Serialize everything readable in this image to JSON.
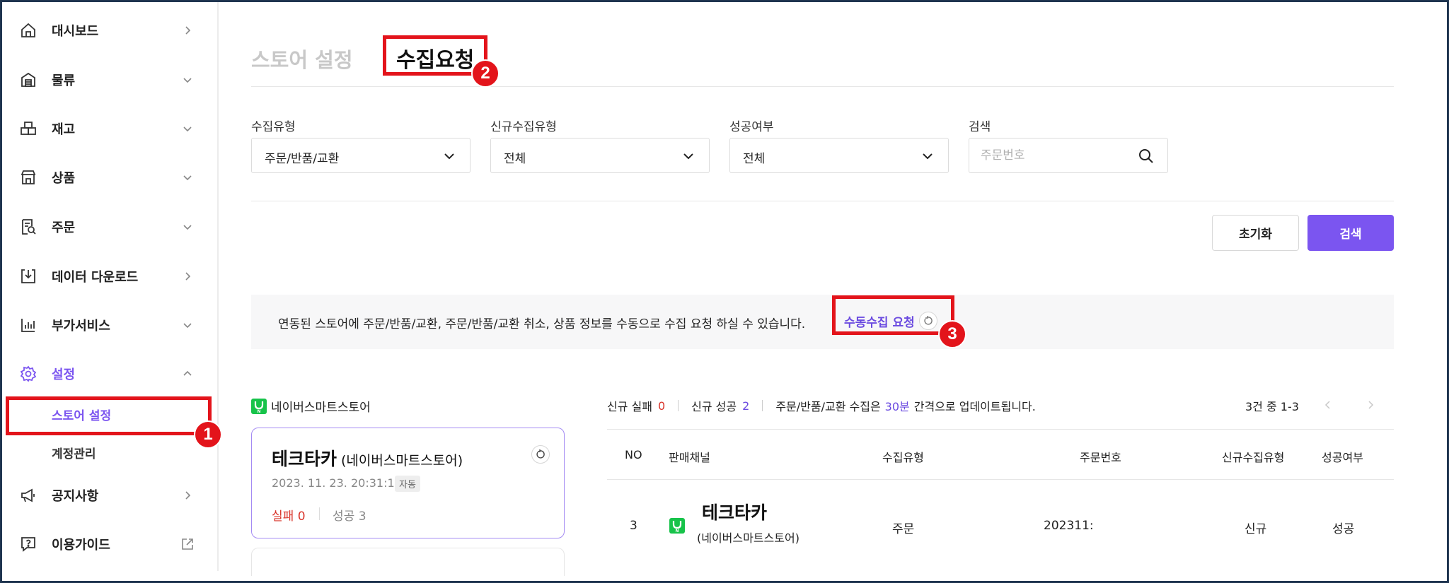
{
  "sidebar": {
    "items": [
      {
        "label": "대시보드",
        "icon": "home-icon"
      },
      {
        "label": "물류",
        "icon": "warehouse-icon"
      },
      {
        "label": "재고",
        "icon": "boxes-icon"
      },
      {
        "label": "상품",
        "icon": "store-icon"
      },
      {
        "label": "주문",
        "icon": "order-list-icon"
      },
      {
        "label": "데이터 다운로드",
        "icon": "download-icon"
      },
      {
        "label": "부가서비스",
        "icon": "chart-plus-icon"
      },
      {
        "label": "설정",
        "icon": "gear-icon"
      },
      {
        "label": "공지사항",
        "icon": "megaphone-icon"
      },
      {
        "label": "이용가이드",
        "icon": "help-icon"
      }
    ],
    "sub_items": [
      {
        "label": "스토어 설정"
      },
      {
        "label": "계정관리"
      }
    ],
    "accent_color": "#7b55f0"
  },
  "tabs": {
    "store_settings": "스토어 설정",
    "collect_request": "수집요청"
  },
  "filters": {
    "collect_type": {
      "label": "수집유형",
      "value": "주문/반품/교환"
    },
    "new_collect_type": {
      "label": "신규수집유형",
      "value": "전체"
    },
    "success": {
      "label": "성공여부",
      "value": "전체"
    },
    "search": {
      "label": "검색",
      "placeholder": "주문번호"
    }
  },
  "buttons": {
    "reset": "초기화",
    "search": "검색"
  },
  "notice": {
    "text": "연동된 스토어에 주문/반품/교환, 주문/반품/교환 취소, 상품 정보를 수동으로 수집 요청 하실 수 있습니다.",
    "manual_request": "수동수집 요청"
  },
  "store_list": {
    "channel_label": "네이버스마트스토어",
    "card": {
      "name": "테크타카",
      "channel": "(네이버스마트스토어)",
      "datetime": "2023. 11. 23. 20:31:12",
      "badge": "자동",
      "fail_label": "실패",
      "fail_count": "0",
      "success_label": "성공",
      "success_count": "3"
    }
  },
  "results": {
    "new_fail_label": "신규 실패",
    "new_fail_count": "0",
    "new_success_label": "신규 성공",
    "new_success_count": "2",
    "interval_prefix": "주문/반품/교환 수집은",
    "interval_value": "30분",
    "interval_suffix": "간격으로 업데이트됩니다.",
    "page_info": "3건 중 1-3",
    "columns": [
      "NO",
      "판매채널",
      "수집유형",
      "주문번호",
      "신규수집유형",
      "성공여부"
    ],
    "rows": [
      {
        "no": "3",
        "channel_name": "테크타카",
        "channel_sub": "(네이버스마트스토어)",
        "collect_type": "주문",
        "order_no": "202311:",
        "new_type": "신규",
        "success": "성공"
      }
    ]
  },
  "annotations": {
    "step1": "1",
    "step2": "2",
    "step3": "3",
    "color": "#e3141b"
  }
}
